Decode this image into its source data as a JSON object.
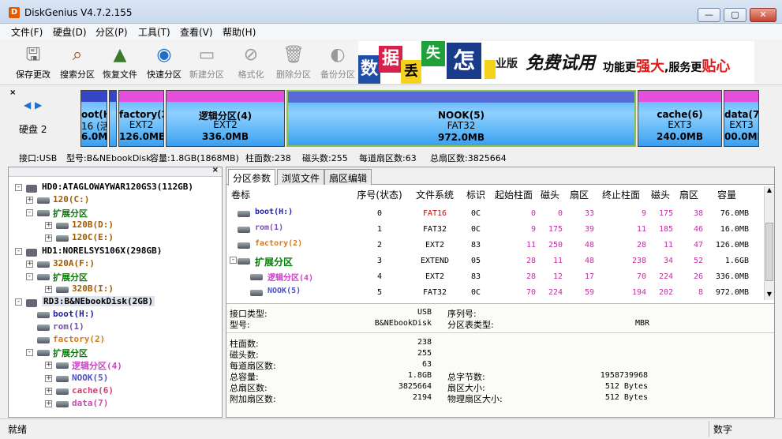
{
  "window": {
    "title": "DiskGenius V4.7.2.155",
    "app_icon": "D",
    "controls": [
      "—",
      "▢",
      "✕"
    ]
  },
  "menu": [
    "文件(F)",
    "硬盘(D)",
    "分区(P)",
    "工具(T)",
    "查看(V)",
    "帮助(H)"
  ],
  "toolbar": [
    {
      "label": "保存更改",
      "icon": "save-icon"
    },
    {
      "label": "搜索分区",
      "icon": "search-icon"
    },
    {
      "label": "恢复文件",
      "icon": "recover-icon"
    },
    {
      "label": "快速分区",
      "icon": "quick-partition-icon"
    },
    {
      "label": "新建分区",
      "icon": "new-partition-icon"
    },
    {
      "label": "格式化",
      "icon": "format-icon"
    },
    {
      "label": "删除分区",
      "icon": "delete-icon"
    },
    {
      "label": "备份分区",
      "icon": "backup-icon"
    }
  ],
  "banner": {
    "tiles": [
      "数",
      "据",
      "丢",
      "失",
      "怎"
    ],
    "text1": "业版",
    "text2": "免费试用",
    "text3a": "功能更",
    "text3b": "强大",
    "text3c": ",服务更",
    "text3d": "贴心"
  },
  "diskmap": {
    "disk_label": "硬盘 2",
    "nav": [
      "◀",
      "▶"
    ],
    "partitions": [
      {
        "name": "oot(H",
        "fs": "16 (活",
        "size": "6.0M"
      },
      {
        "name": "",
        "fs": "",
        "size": ""
      },
      {
        "name": "factory(2)",
        "fs": "EXT2",
        "size": "126.0MB"
      },
      {
        "name": "逻辑分区(4)",
        "fs": "EXT2",
        "size": "336.0MB"
      },
      {
        "name": "NOOK(5)",
        "fs": "FAT32",
        "size": "972.0MB"
      },
      {
        "name": "cache(6)",
        "fs": "EXT3",
        "size": "240.0MB"
      },
      {
        "name": "data(7)",
        "fs": "EXT3",
        "size": "00.0MB"
      }
    ]
  },
  "info": {
    "iface": "接口:USB",
    "model": "型号:B&NEbookDisk",
    "capacity": "容量:1.8GB(1868MB)",
    "cyl": "柱面数:238",
    "heads": "磁头数:255",
    "spt": "每道扇区数:63",
    "total": "总扇区数:3825664"
  },
  "tree": [
    {
      "label": "HD0:ATAGLOWAYWAR120GS3(112GB)",
      "level": 0,
      "color": "#000",
      "box": "-"
    },
    {
      "label": "120(C:)",
      "level": 1,
      "color": "#a05a00",
      "box": "+"
    },
    {
      "label": "扩展分区",
      "level": 1,
      "color": "#0a7a0a",
      "box": "-"
    },
    {
      "label": "120B(D:)",
      "level": 2,
      "color": "#a05a00",
      "box": "+"
    },
    {
      "label": "120C(E:)",
      "level": 2,
      "color": "#a05a00",
      "box": "+"
    },
    {
      "label": "HD1:NORELSYS106X(298GB)",
      "level": 0,
      "color": "#000",
      "box": "-"
    },
    {
      "label": "320A(F:)",
      "level": 1,
      "color": "#a05a00",
      "box": "+"
    },
    {
      "label": "扩展分区",
      "level": 1,
      "color": "#0a7a0a",
      "box": "-"
    },
    {
      "label": "320B(I:)",
      "level": 2,
      "color": "#a05a00",
      "box": "+"
    },
    {
      "label": "RD3:B&NEbookDisk(2GB)",
      "level": 0,
      "color": "#000",
      "box": "-",
      "selected": true
    },
    {
      "label": "boot(H:)",
      "level": 1,
      "color": "#2020a0",
      "box": ""
    },
    {
      "label": "rom(1)",
      "level": 1,
      "color": "#7a4fb0",
      "box": ""
    },
    {
      "label": "factory(2)",
      "level": 1,
      "color": "#d27a1e",
      "box": ""
    },
    {
      "label": "扩展分区",
      "level": 1,
      "color": "#0a7a0a",
      "box": "-"
    },
    {
      "label": "逻辑分区(4)",
      "level": 2,
      "color": "#d040c8",
      "box": "+"
    },
    {
      "label": "NOOK(5)",
      "level": 2,
      "color": "#5050c0",
      "box": "+"
    },
    {
      "label": "cache(6)",
      "level": 2,
      "color": "#d04070",
      "box": "+"
    },
    {
      "label": "data(7)",
      "level": 2,
      "color": "#c050b0",
      "box": "+"
    }
  ],
  "tabs": [
    "分区参数",
    "浏览文件",
    "扇区编辑"
  ],
  "columns": [
    "卷标",
    "序号(状态)",
    "文件系统",
    "标识",
    "起始柱面",
    "磁头",
    "扇区",
    "终止柱面",
    "磁头",
    "扇区",
    "容量"
  ],
  "rows": [
    {
      "label": "boot(H:)",
      "color": "#2020a0",
      "cells": [
        "0",
        "FAT16",
        "0C",
        "0",
        "0",
        "33",
        "9",
        "175",
        "38",
        "76.0MB"
      ],
      "indent": 0
    },
    {
      "label": "rom(1)",
      "color": "#7a4fb0",
      "cells": [
        "1",
        "FAT32",
        "0C",
        "9",
        "175",
        "39",
        "11",
        "185",
        "46",
        "16.0MB"
      ],
      "indent": 0
    },
    {
      "label": "factory(2)",
      "color": "#d27a1e",
      "cells": [
        "2",
        "EXT2",
        "83",
        "11",
        "250",
        "48",
        "28",
        "11",
        "47",
        "126.0MB"
      ],
      "indent": 0
    },
    {
      "label": "扩展分区",
      "color": "#0a7a0a",
      "cells": [
        "3",
        "EXTEND",
        "05",
        "28",
        "11",
        "48",
        "238",
        "34",
        "52",
        "1.6GB"
      ],
      "indent": 0
    },
    {
      "label": "逻辑分区(4)",
      "color": "#d040c8",
      "cells": [
        "4",
        "EXT2",
        "83",
        "28",
        "12",
        "17",
        "70",
        "224",
        "26",
        "336.0MB"
      ],
      "indent": 1
    },
    {
      "label": "NOOK(5)",
      "color": "#5050c0",
      "cells": [
        "5",
        "FAT32",
        "0C",
        "70",
        "224",
        "59",
        "194",
        "202",
        "8",
        "972.0MB"
      ],
      "indent": 1
    }
  ],
  "props": {
    "iface_label": "接口类型:",
    "iface_val": "USB",
    "serial_label": "序列号:",
    "serial_val": "",
    "model_label": "型号:",
    "model_val": "B&NEbookDisk",
    "ptype_label": "分区表类型:",
    "ptype_val": "MBR",
    "cyl_label": "柱面数:",
    "cyl_val": "238",
    "heads_label": "磁头数:",
    "heads_val": "255",
    "spt_label": "每道扇区数:",
    "spt_val": "63",
    "cap_label": "总容量:",
    "cap_val": "1.8GB",
    "bytes_label": "总字节数:",
    "bytes_val": "1958739968",
    "secs_label": "总扇区数:",
    "secs_val": "3825664",
    "secsize_label": "扇区大小:",
    "secsize_val": "512 Bytes",
    "extra_label": "附加扇区数:",
    "extra_val": "2194",
    "phys_label": "物理扇区大小:",
    "phys_val": "512 Bytes"
  },
  "status": {
    "left": "就绪",
    "right": "数字"
  }
}
